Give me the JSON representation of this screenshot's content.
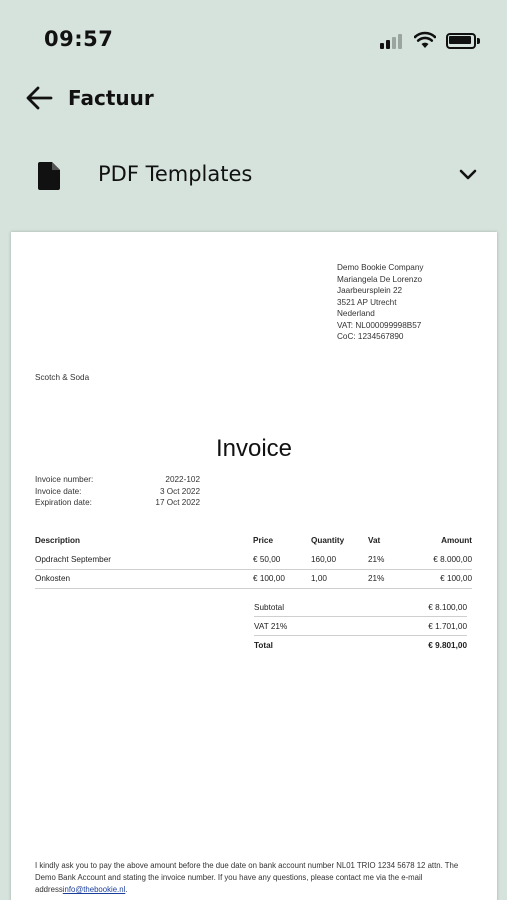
{
  "status_bar": {
    "time": "09:57"
  },
  "header": {
    "title": "Factuur"
  },
  "template_select": {
    "label": "PDF Templates"
  },
  "invoice": {
    "company": {
      "name": "Demo Bookie Company",
      "contact": "Mariangela De Lorenzo",
      "street": "Jaarbeursplein 22",
      "city": "3521 AP Utrecht",
      "country": "Nederland",
      "vat": "VAT: NL000099998B57",
      "coc": "CoC: 1234567890"
    },
    "customer": "Scotch & Soda",
    "title": "Invoice",
    "meta": {
      "number_label": "Invoice number:",
      "number_value": "2022-102",
      "date_label": "Invoice date:",
      "date_value": "3 Oct 2022",
      "expiration_label": "Expiration date:",
      "expiration_value": "17 Oct 2022"
    },
    "columns": {
      "description": "Description",
      "price": "Price",
      "quantity": "Quantity",
      "vat": "Vat",
      "amount": "Amount"
    },
    "lines": [
      {
        "description": "Opdracht September",
        "price": "€ 50,00",
        "quantity": "160,00",
        "vat": "21%",
        "amount": "€ 8.000,00"
      },
      {
        "description": "Onkosten",
        "price": "€ 100,00",
        "quantity": "1,00",
        "vat": "21%",
        "amount": "€ 100,00"
      }
    ],
    "totals": {
      "subtotal_label": "Subtotal",
      "subtotal_value": "€ 8.100,00",
      "vat_label": "VAT 21%",
      "vat_value": "€ 1.701,00",
      "total_label": "Total",
      "total_value": "€ 9.801,00"
    },
    "footer": {
      "text": "I kindly ask you to pay the above amount before the due date on bank account number NL01 TRIO 1234 5678 12 attn. The Demo Bank Account and stating the invoice number. If you have any questions, please contact me via the e-mail address",
      "email": "info@thebookie.nl",
      "end": "."
    }
  }
}
